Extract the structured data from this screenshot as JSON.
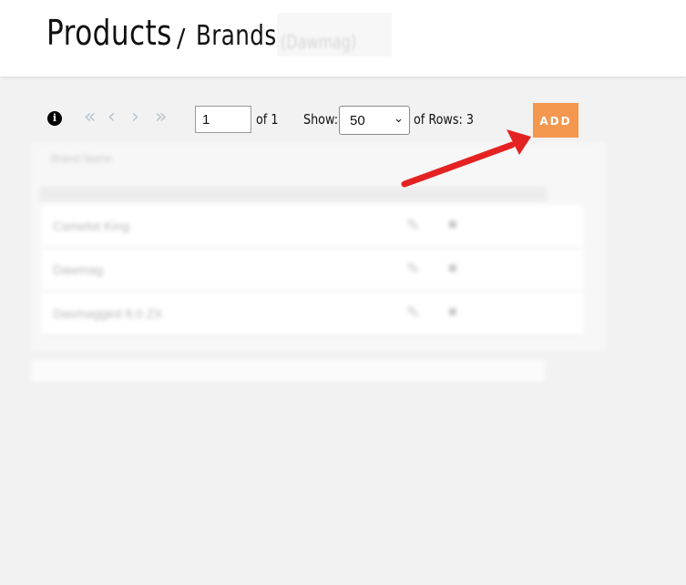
{
  "header": {
    "title": "Products",
    "separator": "/",
    "subtitle": "Brands",
    "obscured_text": "(Dawmag)"
  },
  "pager": {
    "first_icon": "double-chevron-left-icon",
    "prev_icon": "chevron-left-icon",
    "next_icon": "chevron-right-icon",
    "last_icon": "double-chevron-right-icon",
    "page_value": "1",
    "of_label": "of 1",
    "show_label": "Show:",
    "show_value": "50",
    "rows_label": "of Rows: 3"
  },
  "add_label": "ADD",
  "table": {
    "title": "Brand Name",
    "rows": [
      {
        "name": "Camelot King"
      },
      {
        "name": "Dawmag"
      },
      {
        "name": "Dasmagged 8.0 ZX"
      }
    ]
  },
  "colors": {
    "accent": "#f4974f",
    "annotation_arrow": "#e52222",
    "page_background": "#f2f2f2"
  }
}
